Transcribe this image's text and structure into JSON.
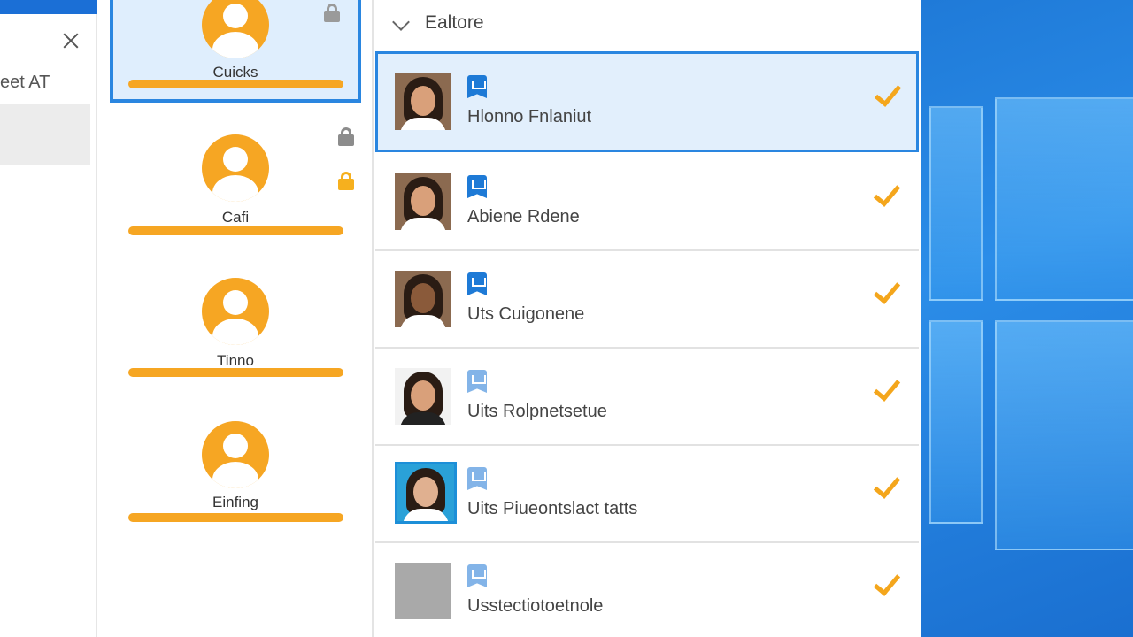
{
  "left_panel": {
    "label": "eet AT"
  },
  "accounts": [
    {
      "name": "Cuicks"
    },
    {
      "name": "Cafi"
    },
    {
      "name": "Tinno"
    },
    {
      "name": "Einfing"
    }
  ],
  "list": {
    "title": "Ealtore",
    "items": [
      {
        "name": "Hlonno Fnlaniut"
      },
      {
        "name": "Abiene Rdene"
      },
      {
        "name": "Uts Cuigonene"
      },
      {
        "name": "Uits Rolpnetsetue"
      },
      {
        "name": "Uits Piueontslact tatts"
      },
      {
        "name": "Usstectiotoetnole"
      }
    ]
  },
  "colors": {
    "accent_blue": "#2a86e0",
    "avatar_orange": "#f6a623",
    "check_orange": "#f4a61c",
    "selected_bg": "#e2effc"
  },
  "icons": [
    "close-icon",
    "lock-icon",
    "chevron-down-icon",
    "account-badge-icon",
    "checkmark-icon",
    "default-avatar-icon"
  ]
}
